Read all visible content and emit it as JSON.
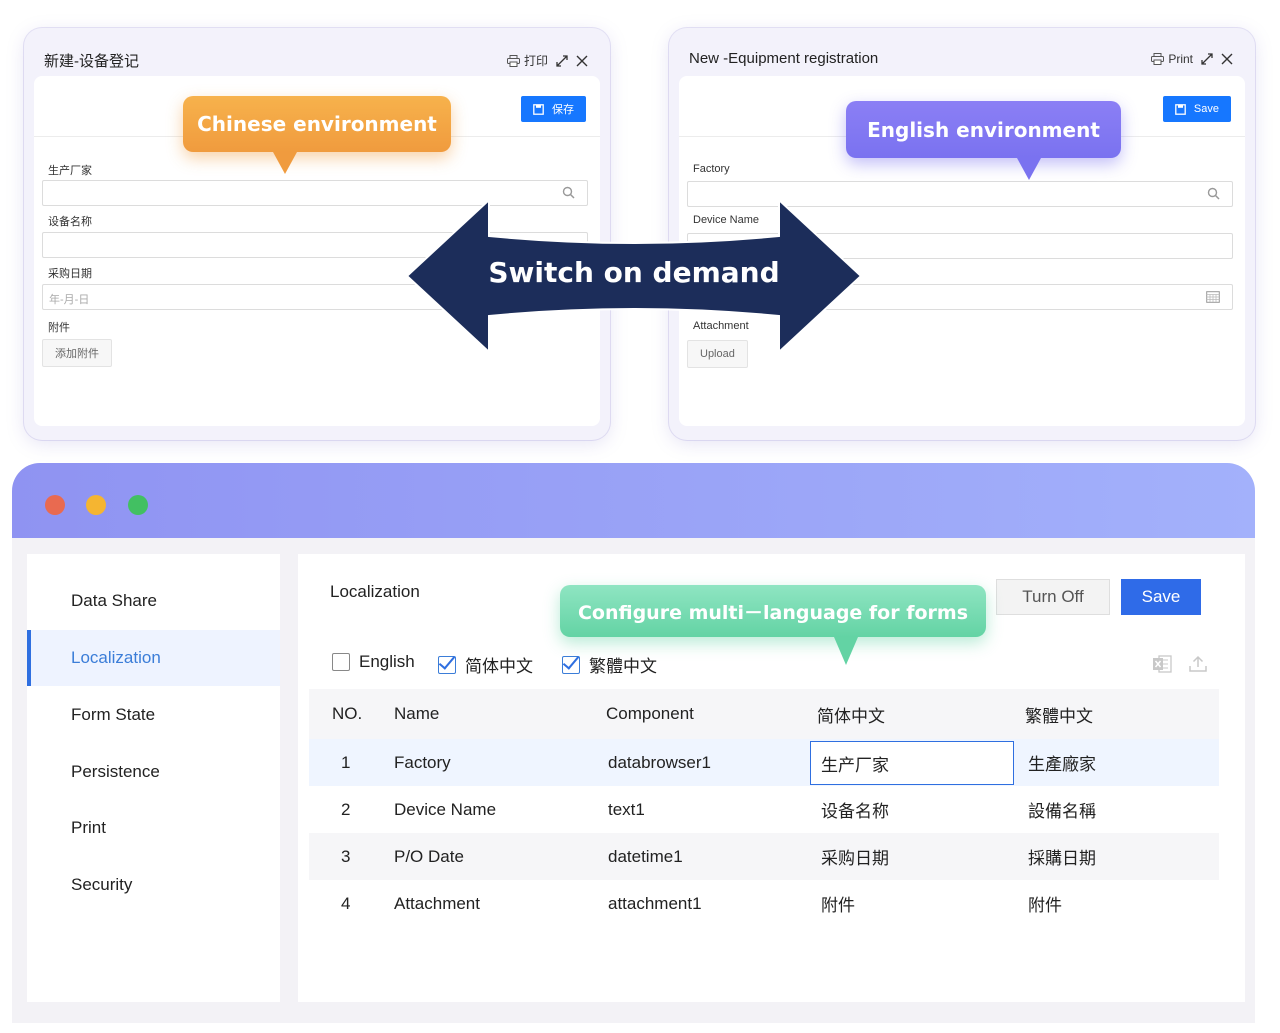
{
  "cn_dialog": {
    "title": "新建-设备登记",
    "print_label": "打印",
    "save_label": "保存",
    "fields": {
      "factory": "生产厂家",
      "device_name": "设备名称",
      "po_date": "采购日期",
      "po_date_placeholder": "年-月-日",
      "attachment": "附件"
    },
    "upload_label": "添加附件"
  },
  "en_dialog": {
    "title": "New -Equipment registration",
    "print_label": "Print",
    "save_label": "Save",
    "fields": {
      "factory": "Factory",
      "device_name": "Device Name",
      "attachment": "Attachment"
    },
    "upload_label": "Upload"
  },
  "callouts": {
    "chinese": "Chinese environment",
    "english": "English environment",
    "switch": "Switch on demand",
    "configure": "Configure multi－language for forms"
  },
  "colors": {
    "accent": "#2f6be8",
    "callout_orange": "#f09b3e",
    "callout_purple": "#7a72f0",
    "callout_green": "#63d3a4",
    "arrow": "#1c2d5a"
  },
  "sidebar": {
    "items": [
      {
        "label": "Data Share",
        "active": false
      },
      {
        "label": "Localization",
        "active": true
      },
      {
        "label": "Form State",
        "active": false
      },
      {
        "label": "Persistence",
        "active": false
      },
      {
        "label": "Print",
        "active": false
      },
      {
        "label": "Security",
        "active": false
      }
    ]
  },
  "main": {
    "heading": "Localization",
    "turn_off_label": "Turn Off",
    "save_label": "Save",
    "languages": [
      {
        "label": "English",
        "checked": false
      },
      {
        "label": "简体中文",
        "checked": true
      },
      {
        "label": "繁體中文",
        "checked": true
      }
    ],
    "toolbar_icons": [
      "excel-export-icon",
      "upload-icon"
    ],
    "table": {
      "columns": [
        "NO.",
        "Name",
        "Component",
        "简体中文",
        "繁體中文"
      ],
      "rows": [
        [
          "1",
          "Factory",
          "databrowser1",
          "生产厂家",
          "生產廠家"
        ],
        [
          "2",
          "Device Name",
          "text1",
          "设备名称",
          "設備名稱"
        ],
        [
          "3",
          "P/O Date",
          "datetime1",
          "采购日期",
          "採購日期"
        ],
        [
          "4",
          "Attachment",
          "attachment1",
          "附件",
          "附件"
        ]
      ]
    }
  }
}
